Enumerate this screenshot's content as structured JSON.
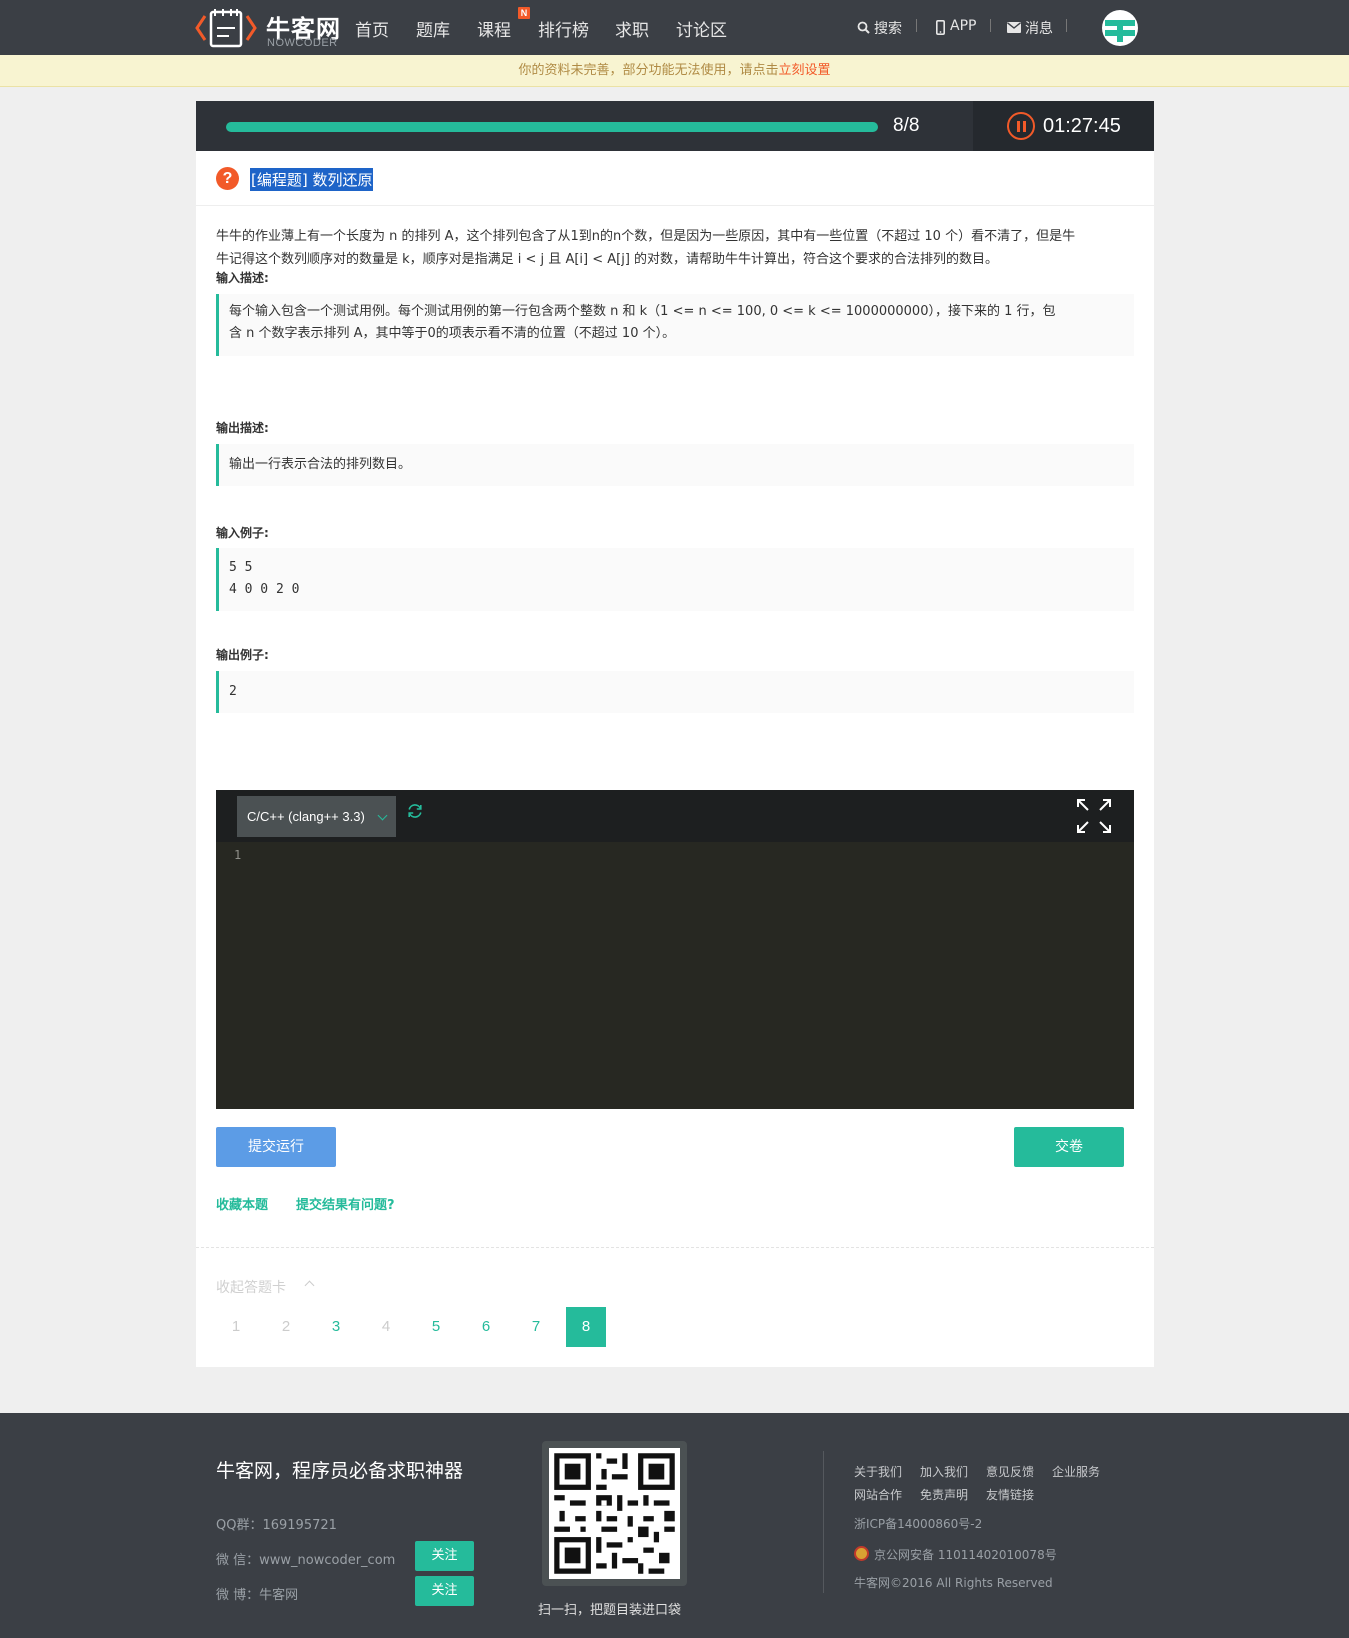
{
  "header": {
    "logo_cn": "牛客网",
    "logo_en": "NOWCODER",
    "nav": [
      "首页",
      "题库",
      "课程",
      "排行榜",
      "求职",
      "讨论区"
    ],
    "nav_badge": "N",
    "search_label": "搜索",
    "app_label": "APP",
    "message_label": "消息"
  },
  "notice": {
    "text": "你的资料未完善，部分功能无法使用，请点击",
    "link": "立刻设置"
  },
  "progress": {
    "count": "8/8",
    "fraction": 1.0,
    "timer": "01:27:45"
  },
  "question": {
    "icon": "?",
    "title": "[编程题] 数列还原",
    "description": [
      "牛牛的作业薄上有一个长度为 n 的排列 A，这个排列包含了从1到n的n个数，但是因为一些原因，其中有一些位置（不超过 10 个）看不清了，但是牛",
      "牛记得这个数列顺序对的数量是 k，顺序对是指满足 i < j 且 A[i] < A[j] 的对数，请帮助牛牛计算出，符合这个要求的合法排列的数目。"
    ],
    "input_heading": "输入描述:",
    "input_lines": [
      "每个输入包含一个测试用例。每个测试用例的第一行包含两个整数 n 和 k（1 <= n <= 100, 0 <= k <= 1000000000），接下来的 1 行，包",
      "含 n 个数字表示排列 A，其中等于0的项表示看不清的位置（不超过 10 个）。"
    ],
    "output_heading": "输出描述:",
    "output_text": "输出一行表示合法的排列数目。",
    "sample_input_heading": "输入例子:",
    "sample_input_lines": [
      "5 5",
      "4 0 0 2 0"
    ],
    "sample_output_heading": "输出例子:",
    "sample_output": "2"
  },
  "editor": {
    "language": "C/C++ (clang++ 3.3)",
    "line_number": "1"
  },
  "actions": {
    "run_label": "提交运行",
    "submit_label": "交卷",
    "favorite_label": "收藏本题",
    "report_label": "提交结果有问题?"
  },
  "answer_card": {
    "collapse_label": "收起答题卡",
    "pages": [
      "1",
      "2",
      "3",
      "4",
      "5",
      "6",
      "7",
      "8"
    ],
    "active": "8"
  },
  "footer": {
    "slogan": "牛客网，程序员必备求职神器",
    "qq": "QQ群：169195721",
    "wechat": "微 信：www_nowcoder_com",
    "weibo": "微 博：牛客网",
    "follow_label": "关注",
    "qr_caption": "扫一扫，把题目装进口袋",
    "links_row1": [
      "关于我们",
      "加入我们",
      "意见反馈",
      "企业服务"
    ],
    "links_row2": [
      "网站合作",
      "免责声明",
      "友情链接"
    ],
    "icp": "浙ICP备14000860号-2",
    "police": "京公网安备 11011402010078号",
    "copyright": "牛客网©2016 All Rights Reserved"
  },
  "colors": {
    "accent": "#25bb9b",
    "header_bg": "#3b3f45",
    "warning": "#f25a29",
    "run_button": "#5c9ce6",
    "editor_bg": "#272822"
  }
}
